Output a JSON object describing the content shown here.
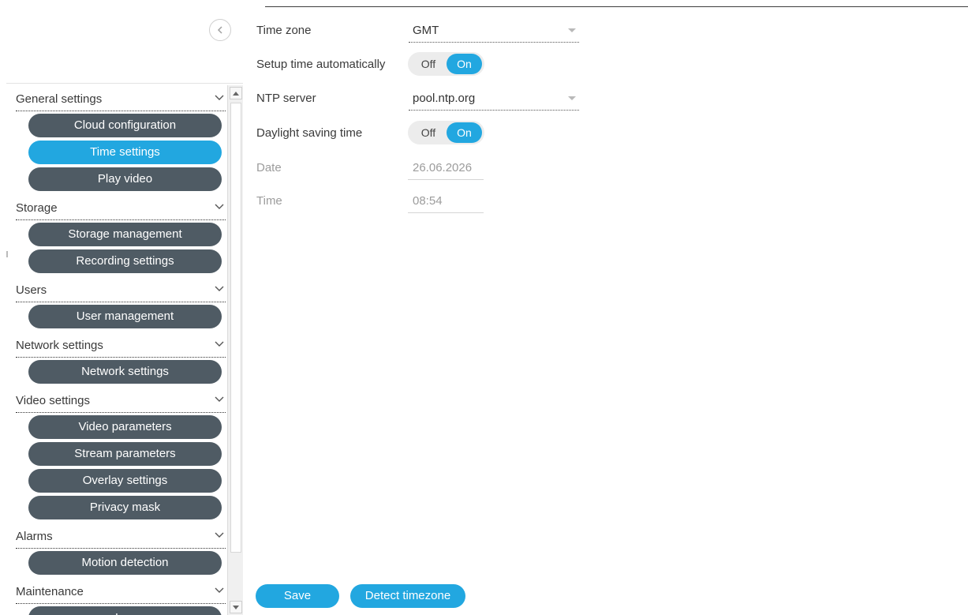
{
  "sidebar": {
    "sections": [
      {
        "label": "General settings",
        "items": [
          "Cloud configuration",
          "Time settings",
          "Play video"
        ]
      },
      {
        "label": "Storage",
        "items": [
          "Storage management",
          "Recording settings"
        ]
      },
      {
        "label": "Users",
        "items": [
          "User management"
        ]
      },
      {
        "label": "Network settings",
        "items": [
          "Network settings"
        ]
      },
      {
        "label": "Video settings",
        "items": [
          "Video parameters",
          "Stream parameters",
          "Overlay settings",
          "Privacy mask"
        ]
      },
      {
        "label": "Alarms",
        "items": [
          "Motion detection"
        ]
      },
      {
        "label": "Maintenance",
        "items": [
          "Log"
        ]
      }
    ],
    "active_item": "Time settings"
  },
  "form": {
    "time_zone": {
      "label": "Time zone",
      "value": "GMT"
    },
    "setup_auto": {
      "label": "Setup time automatically",
      "off": "Off",
      "on": "On",
      "state": "On"
    },
    "ntp_server": {
      "label": "NTP server",
      "value": "pool.ntp.org"
    },
    "daylight": {
      "label": "Daylight saving time",
      "off": "Off",
      "on": "On",
      "state": "On"
    },
    "date": {
      "label": "Date",
      "value": "26.06.2026"
    },
    "time": {
      "label": "Time",
      "value": "08:54"
    }
  },
  "buttons": {
    "save": "Save",
    "detect": "Detect timezone"
  },
  "colors": {
    "accent": "#22a7e0",
    "menu_item": "#4f5b64"
  }
}
